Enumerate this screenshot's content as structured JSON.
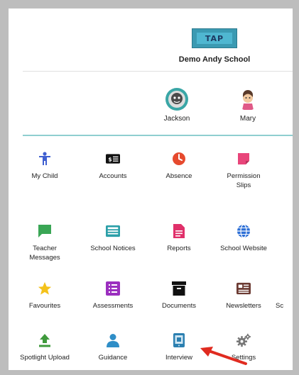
{
  "header": {
    "logo_text": "TAP",
    "school_name": "Demo Andy School"
  },
  "children": [
    {
      "name": "Jackson"
    },
    {
      "name": "Mary"
    }
  ],
  "tiles": {
    "row1": [
      {
        "label": "My Child",
        "icon": "child-icon",
        "color": "#3f5fd0"
      },
      {
        "label": "Accounts",
        "icon": "accounts-icon",
        "color": "#111111"
      },
      {
        "label": "Absence",
        "icon": "clock-icon",
        "color": "#e64a2e"
      },
      {
        "label": "Permission Slips",
        "icon": "permission-slip-icon",
        "color": "#e8457a"
      }
    ],
    "row2": [
      {
        "label": "Teacher Messages",
        "icon": "message-icon",
        "color": "#3aa655"
      },
      {
        "label": "School Notices",
        "icon": "notices-icon",
        "color": "#2b9fa8"
      },
      {
        "label": "Reports",
        "icon": "report-icon",
        "color": "#e0306a"
      },
      {
        "label": "School Website",
        "icon": "globe-icon",
        "color": "#2d6fd6"
      }
    ],
    "row3": [
      {
        "label": "Favourites",
        "icon": "star-icon",
        "color": "#f4c21b"
      },
      {
        "label": "Assessments",
        "icon": "assessments-icon",
        "color": "#9b2fbf"
      },
      {
        "label": "Documents",
        "icon": "archive-icon",
        "color": "#111111"
      },
      {
        "label": "Newsletters",
        "icon": "newsletter-icon",
        "color": "#6b3a32"
      },
      {
        "label": "Sc",
        "icon": "",
        "color": "#222222"
      }
    ],
    "row4": [
      {
        "label": "Spotlight Upload",
        "icon": "upload-icon",
        "color": "#3f9a3c"
      },
      {
        "label": "Guidance",
        "icon": "person-icon",
        "color": "#2f8ec7"
      },
      {
        "label": "Interview",
        "icon": "tablet-icon",
        "color": "#2b7fb0"
      },
      {
        "label": "Settings",
        "icon": "gears-icon",
        "color": "#777777"
      }
    ]
  },
  "annotation": {
    "arrow_color": "#e02b20"
  }
}
